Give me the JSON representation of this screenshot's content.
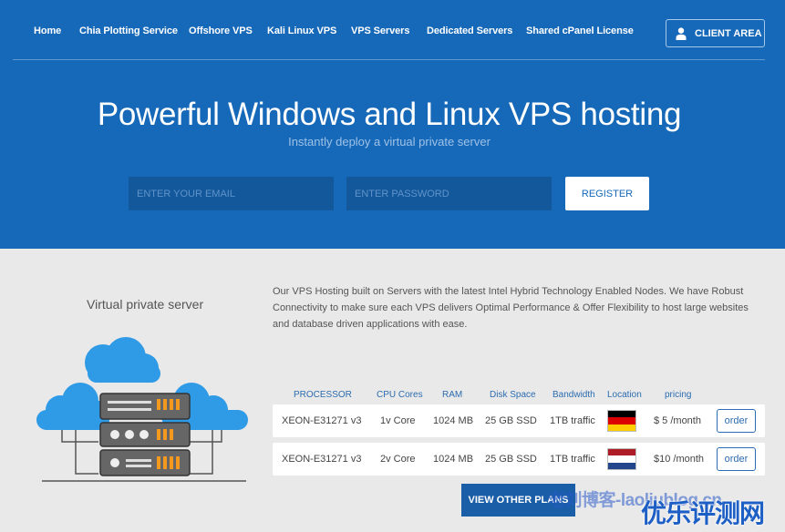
{
  "nav": {
    "items": [
      "Home",
      "Chia Plotting Service",
      "Offshore VPS",
      "Kali Linux VPS",
      "VPS Servers",
      "Dedicated Servers",
      "Shared cPanel License"
    ],
    "client_area": "CLIENT AREA"
  },
  "hero": {
    "title": "Powerful Windows and Linux VPS hosting",
    "subtitle": "Instantly deploy a virtual private server",
    "email_placeholder": "ENTER YOUR EMAIL",
    "password_placeholder": "ENTER PASSWORD",
    "register_label": "REGISTER"
  },
  "content": {
    "side_title": "Virtual private server",
    "description": "Our VPS Hosting built on Servers with the latest Intel Hybrid Technology Enabled Nodes. We have Robust Connectivity to make sure each VPS delivers Optimal Performance & Offer Flexibility to host large websites and database driven applications with ease."
  },
  "plans": {
    "headers": [
      "PROCESSOR",
      "CPU Cores",
      "RAM",
      "Disk Space",
      "Bandwidth",
      "Location",
      "pricing"
    ],
    "rows": [
      {
        "processor": "XEON-E31271 v3",
        "cores": "1v Core",
        "ram": "1024 MB",
        "disk": "25 GB SSD",
        "bandwidth": "1TB traffic",
        "location": "germany-flag",
        "price": "$ 5 /month",
        "order": "order"
      },
      {
        "processor": "XEON-E31271 v3",
        "cores": "2v Core",
        "ram": "1024 MB",
        "disk": "25 GB SSD",
        "bandwidth": "1TB traffic",
        "location": "netherlands-flag",
        "price": "$10 /month",
        "order": "order"
      }
    ],
    "view_other": "VIEW OTHER PLANS"
  },
  "watermark": {
    "blog": "老刘博客-laoliublog.cn",
    "site": "优乐评测网"
  },
  "colors": {
    "hero_bg": "#1668b8",
    "accent": "#2c6cb0",
    "page_bg": "#e9e9e9"
  }
}
